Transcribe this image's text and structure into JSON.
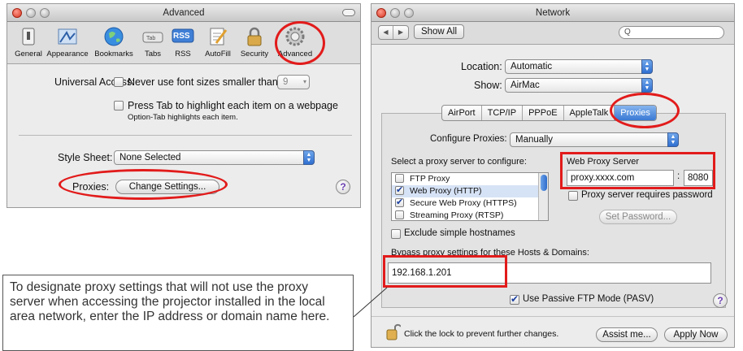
{
  "left_window": {
    "title": "Advanced",
    "toolbar": [
      {
        "label": "General",
        "icon": "general-switch-icon"
      },
      {
        "label": "Appearance",
        "icon": "appearance-icon"
      },
      {
        "label": "Bookmarks",
        "icon": "bookmarks-globe-icon"
      },
      {
        "label": "Tabs",
        "icon": "tabs-icon"
      },
      {
        "label": "RSS",
        "icon": "rss-icon"
      },
      {
        "label": "AutoFill",
        "icon": "autofill-icon"
      },
      {
        "label": "Security",
        "icon": "security-lock-icon"
      },
      {
        "label": "Advanced",
        "icon": "advanced-gear-icon"
      }
    ],
    "toolbar_icon_text": {
      "tabs": "Tab",
      "rss": "RSS"
    },
    "universal_access_label": "Universal Access:",
    "never_font_label": "Never use font sizes smaller than",
    "font_size_value": "9",
    "press_tab_label": "Press Tab to highlight each item on a webpage",
    "option_tab_note": "Option-Tab highlights each item.",
    "style_sheet_label": "Style Sheet:",
    "style_sheet_value": "None Selected",
    "proxies_label": "Proxies:",
    "change_settings_label": "Change Settings...",
    "help_label": "?"
  },
  "right_window": {
    "title": "Network",
    "show_all_label": "Show All",
    "search_placeholder": "Q",
    "location_label": "Location:",
    "location_value": "Automatic",
    "show_label": "Show:",
    "show_value": "AirMac",
    "tabs": [
      "AirPort",
      "TCP/IP",
      "PPPoE",
      "AppleTalk",
      "Proxies"
    ],
    "active_tab": "Proxies",
    "configure_proxies_label": "Configure Proxies:",
    "configure_proxies_value": "Manually",
    "select_proxy_label": "Select a proxy server to configure:",
    "proxy_list": [
      {
        "label": "FTP Proxy",
        "checked": false
      },
      {
        "label": "Web Proxy (HTTP)",
        "checked": true
      },
      {
        "label": "Secure Web Proxy (HTTPS)",
        "checked": true
      },
      {
        "label": "Streaming Proxy (RTSP)",
        "checked": false
      }
    ],
    "web_proxy_server_label": "Web Proxy Server",
    "proxy_host": "proxy.xxxx.com",
    "proxy_port": "8080",
    "colon": ":",
    "requires_password_label": "Proxy server requires password",
    "set_password_label": "Set Password...",
    "exclude_simple_label": "Exclude simple hostnames",
    "bypass_label": "Bypass proxy settings for these Hosts & Domains:",
    "bypass_value": "192.168.1.201",
    "passive_ftp_label": "Use Passive FTP Mode (PASV)",
    "lock_text": "Click the lock to prevent further changes.",
    "assist_label": "Assist me...",
    "apply_label": "Apply Now",
    "help_label": "?"
  },
  "callout": {
    "text": "To designate proxy settings that will not use the proxy server when accessing the projector installed in the local area network, enter the IP address or domain name here."
  },
  "colors": {
    "annotation_red": "#e21b1b",
    "aqua_blue": "#3a79d4"
  }
}
